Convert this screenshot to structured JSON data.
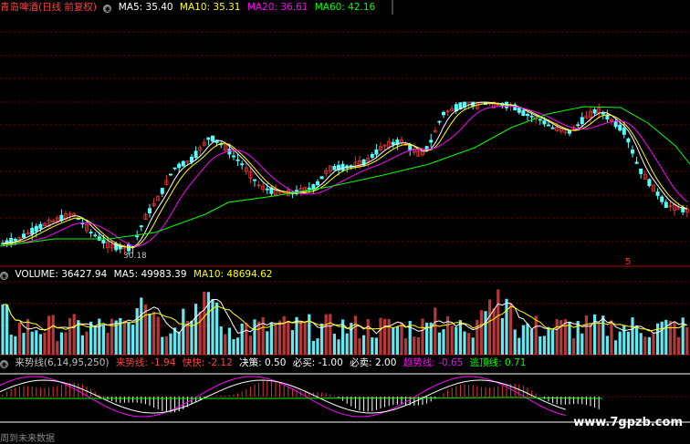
{
  "colors": {
    "up": "#e23636",
    "down": "#54ffff",
    "ma5": "#ffffff",
    "ma10": "#ffff00",
    "ma20": "#ff00ff",
    "ma60": "#00ff00",
    "grid": "#7a0000",
    "text": "#c0c0c0",
    "accent": "#ff3030",
    "vol_up": "#b83838",
    "vol_down": "#62e8f0",
    "white": "#ffffff"
  },
  "price_header": {
    "stock": "青岛啤酒(日线 前复权)",
    "icon": "settings-circle-icon",
    "ma5": "MA5: 35.40",
    "ma10": "MA10: 35.31",
    "ma20": "MA20: 36.61",
    "ma60": "MA60: 42.16"
  },
  "price_annotations": {
    "low_label": "30.18",
    "marker": "5"
  },
  "volume_header": {
    "label": "VOLUME: 36427.94",
    "ma5": "MA5: 49983.39",
    "ma10": "MA10: 48694.62"
  },
  "indicator_header": {
    "name": "来势线(6,14,95,250)",
    "v1_label": "来势线: -1.94",
    "v2_label": "快快: -2.12",
    "v3_label": "决策: 0.50",
    "v4_label": "必买: -1.00",
    "v5_label": "必卖: 2.00",
    "v6_label": "趋势线: -0.65",
    "v7_label": "逃顶线: 0.71"
  },
  "watermark": "www.7gpzb.com",
  "footer": "周到未来数据"
}
